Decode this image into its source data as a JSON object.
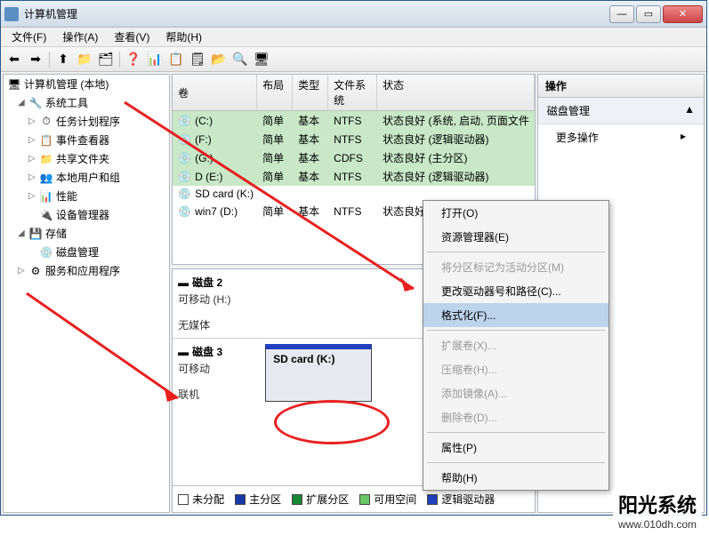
{
  "window": {
    "title": "计算机管理"
  },
  "win_controls": {
    "min": "—",
    "max": "▭",
    "close": "✕"
  },
  "menu": {
    "file": "文件(F)",
    "action": "操作(A)",
    "view": "查看(V)",
    "help": "帮助(H)"
  },
  "toolbar_icons": [
    "⬅",
    "➡",
    "⬆",
    "📁",
    "🗂",
    "❓",
    "📊",
    "📋",
    "🗒",
    "📂",
    "🔍",
    "🖥"
  ],
  "tree": {
    "root": "计算机管理 (本地)",
    "system_tools": "系统工具",
    "task_scheduler": "任务计划程序",
    "event_viewer": "事件查看器",
    "shared_folders": "共享文件夹",
    "local_users": "本地用户和组",
    "performance": "性能",
    "device_manager": "设备管理器",
    "storage": "存储",
    "disk_management": "磁盘管理",
    "services": "服务和应用程序"
  },
  "volumes": {
    "headers": {
      "volume": "卷",
      "layout": "布局",
      "type": "类型",
      "filesystem": "文件系统",
      "status": "状态"
    },
    "rows": [
      {
        "vol": "(C:)",
        "layout": "简单",
        "type": "基本",
        "fs": "NTFS",
        "status": "状态良好 (系统, 启动, 页面文件"
      },
      {
        "vol": "(F:)",
        "layout": "简单",
        "type": "基本",
        "fs": "NTFS",
        "status": "状态良好 (逻辑驱动器)"
      },
      {
        "vol": "(G:)",
        "layout": "简单",
        "type": "基本",
        "fs": "CDFS",
        "status": "状态良好 (主分区)"
      },
      {
        "vol": "D (E:)",
        "layout": "简单",
        "type": "基本",
        "fs": "NTFS",
        "status": "状态良好 (逻辑驱动器)"
      },
      {
        "vol": "SD card (K:)",
        "layout": "",
        "type": "",
        "fs": "",
        "status": ""
      },
      {
        "vol": "win7 (D:)",
        "layout": "简单",
        "type": "基本",
        "fs": "NTFS",
        "status": "状态良好 (逻辑驱动器)"
      }
    ]
  },
  "disks": {
    "disk2": {
      "title": "磁盘 2",
      "sub1": "可移动 (H:)",
      "sub2": "无媒体"
    },
    "disk3": {
      "title": "磁盘 3",
      "sub1": "可移动",
      "sub2": "联机",
      "part_label": "SD card  (K:)"
    }
  },
  "legend": {
    "unallocated": {
      "label": "未分配",
      "color": "#000000"
    },
    "primary": {
      "label": "主分区",
      "color": "#1838a8"
    },
    "extended": {
      "label": "扩展分区",
      "color": "#188838"
    },
    "free": {
      "label": "可用空间",
      "color": "#68c868"
    },
    "logical": {
      "label": "逻辑驱动器",
      "color": "#2040c0"
    }
  },
  "actions_panel": {
    "header": "操作",
    "section": "磁盘管理",
    "more": "更多操作",
    "arrow_up": "▲",
    "arrow_right": "▸"
  },
  "context_menu": {
    "open": "打开(O)",
    "explorer": "资源管理器(E)",
    "mark_active": "将分区标记为活动分区(M)",
    "change_letter": "更改驱动器号和路径(C)...",
    "format": "格式化(F)...",
    "extend": "扩展卷(X)...",
    "shrink": "压缩卷(H)...",
    "mirror": "添加镜像(A)...",
    "delete": "删除卷(D)...",
    "properties": "属性(P)",
    "help": "帮助(H)"
  },
  "watermark": {
    "main": "阳光系统",
    "sub": "www.010dh.com"
  }
}
